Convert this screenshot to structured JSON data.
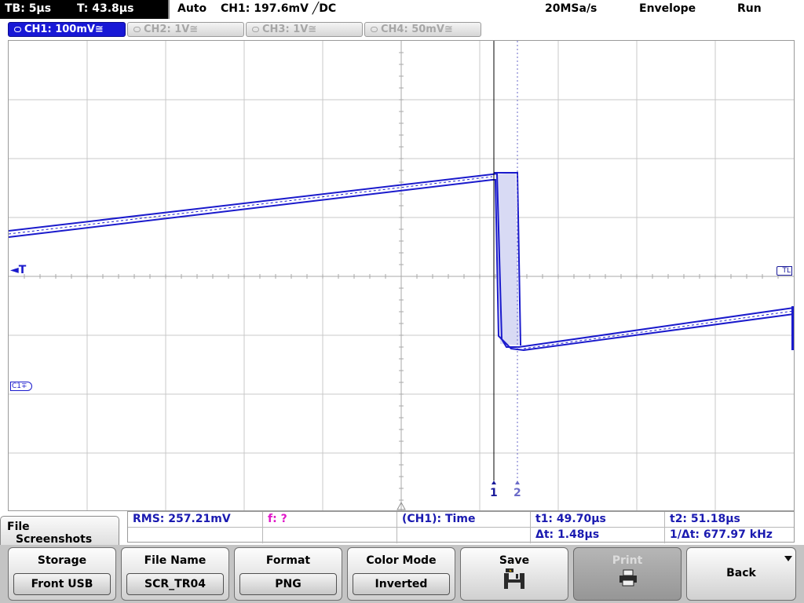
{
  "status": {
    "timebase": "TB: 5µs",
    "delay": "T: 43.8µs",
    "trigger_mode": "Auto",
    "trigger_level": "CH1: 197.6mV ╱DC",
    "sample_rate": "20MSa/s",
    "acquire_mode": "Envelope",
    "run_state": "Run"
  },
  "channels": [
    {
      "label": "CH1: 100mV≅",
      "active": true
    },
    {
      "label": "CH2: 1V≅",
      "active": false
    },
    {
      "label": "CH3: 1V≅",
      "active": false
    },
    {
      "label": "CH4: 50mV≅",
      "active": false
    }
  ],
  "markers": {
    "trigger": "◄T",
    "trigger_level": "TL",
    "channel_ref": "C1∓",
    "cursor1": "1",
    "cursor2": "2"
  },
  "measurements": {
    "rms": "RMS: 257.21mV",
    "freq": "f: ?",
    "source": "(CH1): Time",
    "t1": "t1: 49.70µs",
    "t2": "t2: 51.18µs",
    "dt": "Δt: 1.48µs",
    "inv_dt": "1/Δt: 677.97 kHz"
  },
  "menu": {
    "title_line1": "File",
    "title_line2": "Screenshots"
  },
  "softkeys": {
    "storage": {
      "title": "Storage",
      "value": "Front USB"
    },
    "file_name": {
      "title": "File Name",
      "value": "SCR_TR04"
    },
    "format": {
      "title": "Format",
      "value": "PNG"
    },
    "color_mode": {
      "title": "Color Mode",
      "value": "Inverted"
    },
    "save": {
      "title": "Save"
    },
    "print": {
      "title": "Print"
    },
    "back": {
      "title": "Back"
    }
  },
  "colors": {
    "trace": "#1a1acc",
    "envelope_fill": "#d8daf4",
    "active_channel": "#1818d6",
    "cursor2": "#6a6ac8",
    "grid": "#c8c8c8"
  },
  "icons": [
    "floppy-disk-icon",
    "printer-icon",
    "triangle-corner-icon"
  ]
}
